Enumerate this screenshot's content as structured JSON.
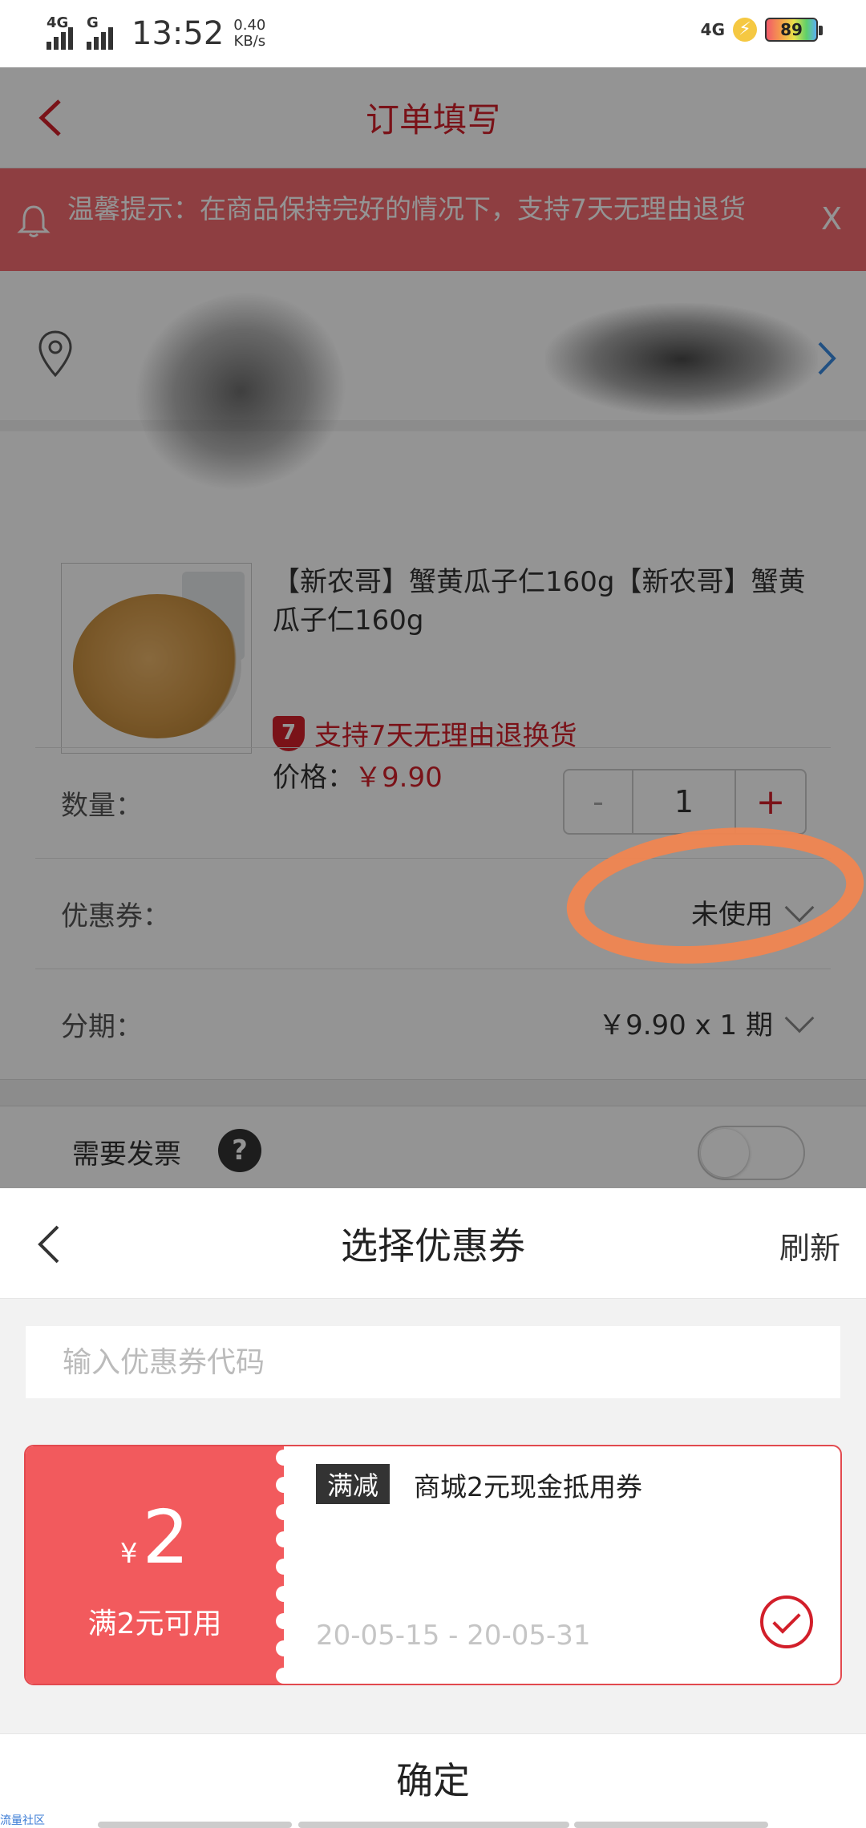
{
  "status": {
    "net1": "4G",
    "net2": "G",
    "time": "13:52",
    "speed_value": "0.40",
    "speed_unit": "KB/s",
    "net_right": "4G",
    "battery": "89"
  },
  "page": {
    "title": "订单填写",
    "notice": "温馨提示：在商品保持完好的情况下，支持7天无理由退货",
    "notice_close": "X",
    "product": {
      "title": "【新农哥】蟹黄瓜子仁160g【新农哥】蟹黄瓜子仁160g",
      "badge_num": "7",
      "badge_text": "支持7天无理由退换货",
      "price_label": "价格：",
      "price_value": "￥9.90"
    },
    "quantity": {
      "label": "数量：",
      "minus": "-",
      "value": "1",
      "plus": "+"
    },
    "coupon": {
      "label": "优惠券：",
      "value": "未使用"
    },
    "installment": {
      "label": "分期：",
      "value": "￥9.90 x 1 期"
    },
    "invoice": {
      "label": "需要发票",
      "help": "?"
    }
  },
  "sheet": {
    "title": "选择优惠券",
    "refresh": "刷新",
    "code_placeholder": "输入优惠券代码",
    "coupon": {
      "currency": "¥",
      "amount": "2",
      "condition": "满2元可用",
      "tag": "满减",
      "name": "商城2元现金抵用券",
      "dates": "20-05-15 - 20-05-31",
      "selected": true
    },
    "confirm": "确定"
  },
  "watermark": "流量社区",
  "colors": {
    "brand_red": "#d21f2a",
    "notice_bg": "#f46c70",
    "coupon_red": "#f25a5d",
    "annotation_orange": "#f08550"
  }
}
